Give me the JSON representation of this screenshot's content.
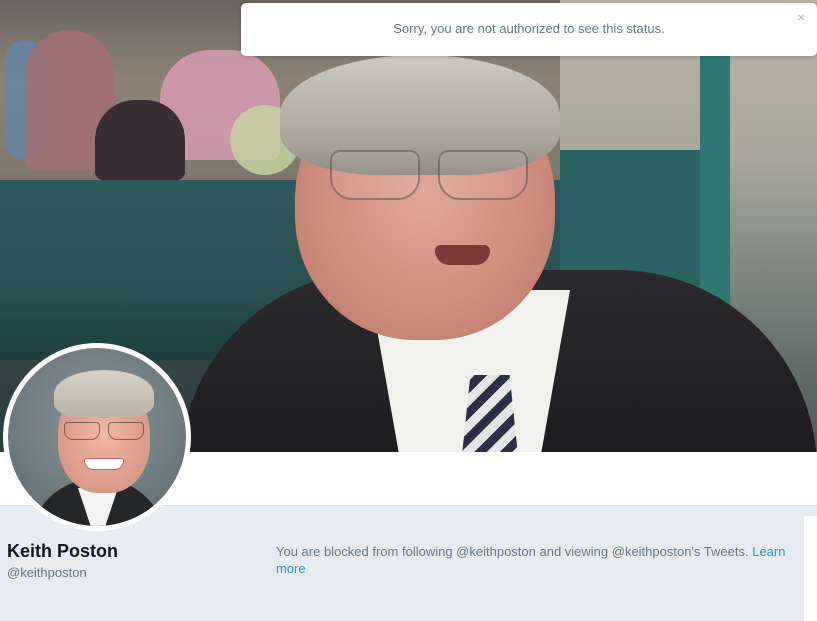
{
  "alert": {
    "message": "Sorry, you are not authorized to see this status.",
    "close_glyph": "×",
    "close_icon": "close-icon"
  },
  "profile": {
    "name": "Keith Poston",
    "handle": "@keithposton",
    "blocked_message": "You are blocked from following @keithposton and viewing @keithposton's Tweets.",
    "learn_more_label": "Learn more"
  },
  "colors": {
    "link": "#1b95e0",
    "secondary_text": "#657786",
    "page_background": "#e6ecf0"
  }
}
